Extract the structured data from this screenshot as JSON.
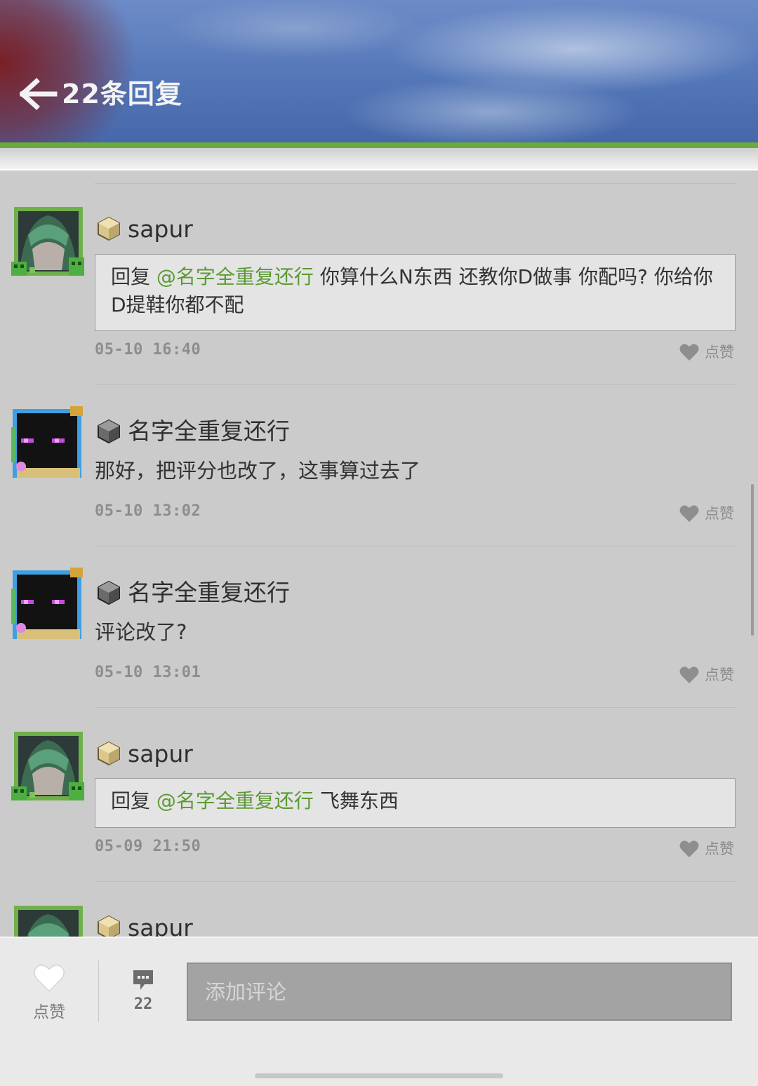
{
  "header": {
    "title": "22条回复"
  },
  "colors": {
    "accent_green": "#6aaa3e",
    "mention_green": "#5a9a32"
  },
  "comments": [
    {
      "user": "sapur",
      "avatar": "anime-girl-avatar",
      "badge": "gold-block-icon",
      "reply_prefix": "回复",
      "mention": "@名字全重复还行",
      "text": " 你算什么N东西 还教你D做事 你配吗?  你给你D提鞋你都不配",
      "time": "05-10 16:40",
      "like_label": "点赞"
    },
    {
      "user": "名字全重复还行",
      "avatar": "enderman-avatar",
      "badge": "stone-block-icon",
      "text": "那好，把评分也改了，这事算过去了",
      "time": "05-10 13:02",
      "like_label": "点赞"
    },
    {
      "user": "名字全重复还行",
      "avatar": "enderman-avatar",
      "badge": "stone-block-icon",
      "text": "评论改了?",
      "time": "05-10 13:01",
      "like_label": "点赞"
    },
    {
      "user": "sapur",
      "avatar": "anime-girl-avatar",
      "badge": "gold-block-icon",
      "reply_prefix": "回复",
      "mention": "@名字全重复还行",
      "text": " 飞舞东西",
      "time": "05-09 21:50",
      "like_label": "点赞"
    },
    {
      "user": "sapur",
      "avatar": "anime-girl-avatar",
      "badge": "gold-block-icon"
    }
  ],
  "bottom_bar": {
    "like_label": "点赞",
    "comment_count": "22",
    "input_placeholder": "添加评论"
  }
}
